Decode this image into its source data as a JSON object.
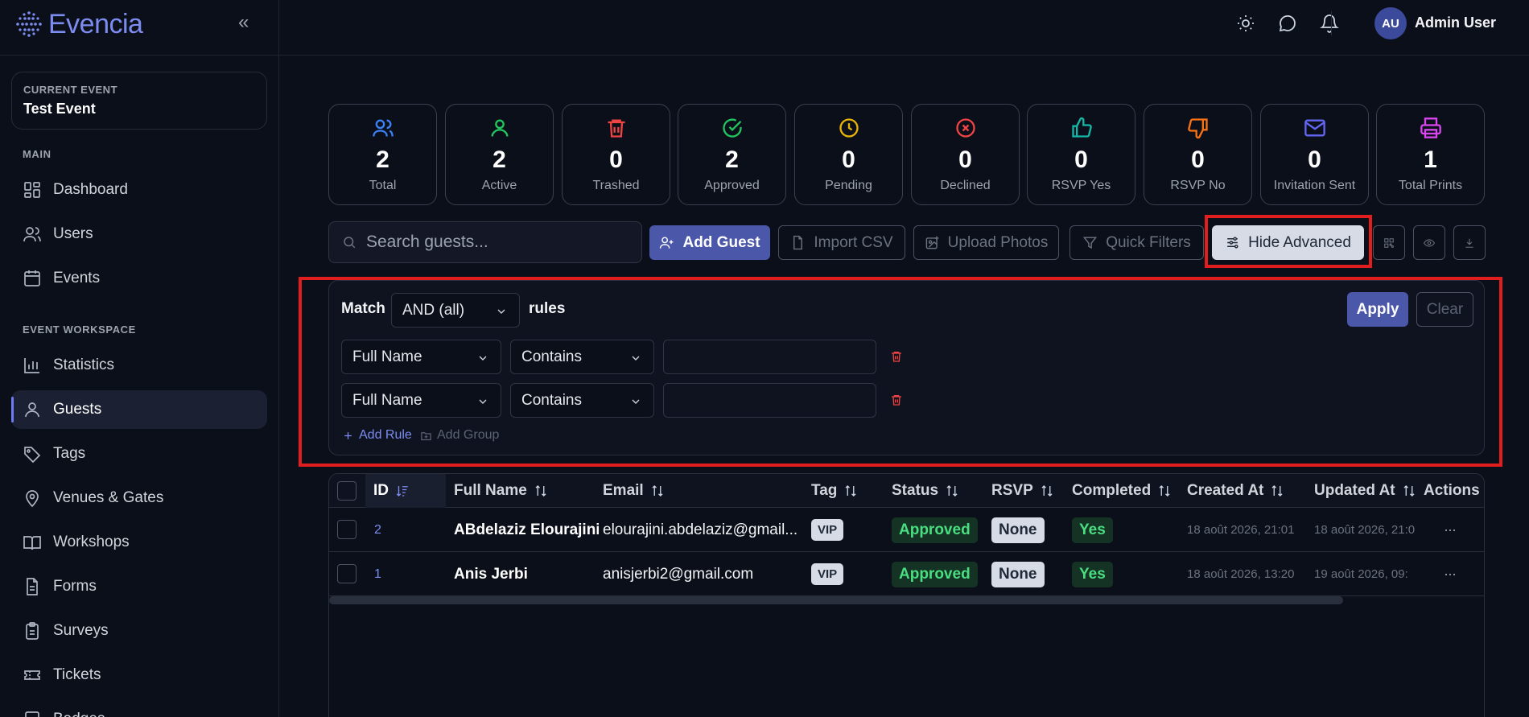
{
  "app": {
    "logo_text": "Evencia",
    "collapse_glyph": "«"
  },
  "current_event": {
    "label": "CURRENT EVENT",
    "name": "Test Event"
  },
  "sidebar": {
    "main_label": "MAIN",
    "workspace_label": "EVENT WORKSPACE",
    "main_items": [
      {
        "label": "Dashboard",
        "icon": "dashboard-icon"
      },
      {
        "label": "Users",
        "icon": "users-icon"
      },
      {
        "label": "Events",
        "icon": "calendar-icon"
      }
    ],
    "workspace_items": [
      {
        "label": "Statistics",
        "icon": "bar-chart-icon"
      },
      {
        "label": "Guests",
        "icon": "user-icon",
        "active": true
      },
      {
        "label": "Tags",
        "icon": "tags-icon"
      },
      {
        "label": "Venues & Gates",
        "icon": "map-pin-icon"
      },
      {
        "label": "Workshops",
        "icon": "book-icon"
      },
      {
        "label": "Forms",
        "icon": "file-text-icon"
      },
      {
        "label": "Surveys",
        "icon": "clipboard-icon"
      },
      {
        "label": "Tickets",
        "icon": "ticket-icon"
      },
      {
        "label": "Badges",
        "icon": "badge-icon"
      }
    ]
  },
  "header": {
    "avatar_initials": "AU",
    "user_name": "Admin User"
  },
  "stats": [
    {
      "value": "2",
      "label": "Total",
      "icon": "users-icon",
      "color": "#3b82f6"
    },
    {
      "value": "2",
      "label": "Active",
      "icon": "user-icon",
      "color": "#22c55e"
    },
    {
      "value": "0",
      "label": "Trashed",
      "icon": "trash-icon",
      "color": "#ef4444"
    },
    {
      "value": "2",
      "label": "Approved",
      "icon": "check-circle-icon",
      "color": "#22c55e"
    },
    {
      "value": "0",
      "label": "Pending",
      "icon": "clock-icon",
      "color": "#eab308"
    },
    {
      "value": "0",
      "label": "Declined",
      "icon": "x-circle-icon",
      "color": "#ef4444"
    },
    {
      "value": "0",
      "label": "RSVP Yes",
      "icon": "thumbs-up-icon",
      "color": "#14b8a6"
    },
    {
      "value": "0",
      "label": "RSVP No",
      "icon": "thumbs-down-icon",
      "color": "#f97316"
    },
    {
      "value": "0",
      "label": "Invitation Sent",
      "icon": "mail-icon",
      "color": "#6366f1"
    },
    {
      "value": "1",
      "label": "Total Prints",
      "icon": "printer-icon",
      "color": "#d946ef"
    }
  ],
  "toolbar": {
    "search_placeholder": "Search guests...",
    "add_guest": "Add Guest",
    "import_csv": "Import CSV",
    "upload_photos": "Upload Photos",
    "quick_filters": "Quick Filters",
    "hide_advanced": "Hide Advanced"
  },
  "advanced": {
    "match_label": "Match",
    "match_value": "AND (all)",
    "rules_label": "rules",
    "apply": "Apply",
    "clear": "Clear",
    "rules": [
      {
        "field": "Full Name",
        "operator": "Contains",
        "value": ""
      },
      {
        "field": "Full Name",
        "operator": "Contains",
        "value": ""
      }
    ],
    "add_rule": "Add Rule",
    "add_group": "Add Group"
  },
  "table": {
    "columns": [
      "ID",
      "Full Name",
      "Email",
      "Tag",
      "Status",
      "RSVP",
      "Completed",
      "Created At",
      "Updated At",
      "Actions"
    ],
    "rows": [
      {
        "id": "2",
        "name": "ABdelaziz Elourajini",
        "email": "elourajini.abdelaziz@gmail...",
        "tag": "VIP",
        "status": "Approved",
        "rsvp": "None",
        "completed": "Yes",
        "created": "18 août 2026, 21:01",
        "updated": "18 août 2026, 21:0",
        "actions": "···"
      },
      {
        "id": "1",
        "name": "Anis Jerbi",
        "email": "anisjerbi2@gmail.com",
        "tag": "VIP",
        "status": "Approved",
        "rsvp": "None",
        "completed": "Yes",
        "created": "18 août 2026, 13:20",
        "updated": "19 août 2026, 09:",
        "actions": "···"
      }
    ]
  },
  "colors": {
    "accent": "#4b57a8",
    "highlight": "#e01e1e",
    "background": "#0b0f19"
  }
}
